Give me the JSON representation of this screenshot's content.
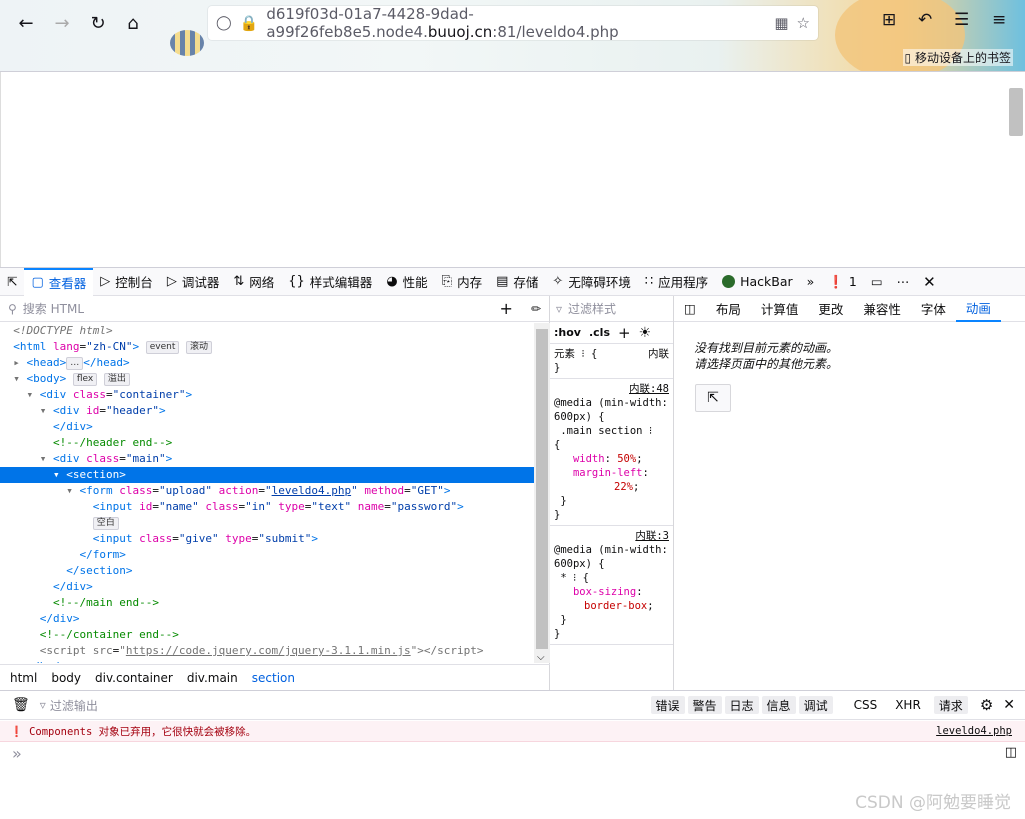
{
  "browser": {
    "url_gray_prefix": "d619f03d-01a7-4428-9dad-a99f26feb8e5.node4.",
    "url_domain": "buuoj.cn",
    "url_suffix": ":81/leveldo4.php",
    "bookmark_hint": "移动设备上的书签"
  },
  "devtools": {
    "tabs": [
      "查看器",
      "控制台",
      "调试器",
      "网络",
      "样式编辑器",
      "性能",
      "内存",
      "存储",
      "无障碍环境",
      "应用程序",
      "HackBar"
    ],
    "error_count": "1",
    "search_placeholder": "搜索 HTML",
    "markup": {
      "doctype": "<!DOCTYPE html>",
      "html_lang": "zh-CN",
      "badge_event": "event",
      "badge_scroll": "滚动",
      "badge_flex": "flex",
      "badge_overflow": "溢出",
      "badge_whitespace": "空白",
      "header_end": "<!--/header end-->",
      "main_end": "<!--/main end-->",
      "container_end": "<!--/container end-->",
      "script_src": "https://code.jquery.com/jquery-3.1.1.min.js",
      "form_action": "leveldo4.php",
      "form_method": "GET",
      "input1_id": "name",
      "input1_class": "in",
      "input1_type": "text",
      "input1_name": "password",
      "input2_class": "give",
      "input2_type": "submit"
    },
    "breadcrumbs": [
      "html",
      "body",
      "div.container",
      "div.main",
      "section"
    ],
    "rules": {
      "filter_placeholder": "过滤样式",
      "hov": ":hov",
      "cls": ".cls",
      "element_label": "元素",
      "inline_label": "内联",
      "src1": "内联:48",
      "src2": "内联:3",
      "media": "@media (min-width: 600px) {",
      "selector1": ".main section",
      "width": "50%",
      "margin_left": "22%",
      "box_sizing": "border-box"
    },
    "side_tabs": [
      "布局",
      "计算值",
      "更改",
      "兼容性",
      "字体",
      "动画"
    ],
    "anim_line1": "没有找到目前元素的动画。",
    "anim_line2": "请选择页面中的其他元素。"
  },
  "console": {
    "filter_placeholder": "过滤输出",
    "filters": [
      "错误",
      "警告",
      "日志",
      "信息",
      "调试",
      "CSS",
      "XHR",
      "请求"
    ],
    "message": "Components 对象已弃用，它很快就会被移除。",
    "message_source": "leveldo4.php"
  },
  "watermark": "CSDN @阿勉要睡觉"
}
